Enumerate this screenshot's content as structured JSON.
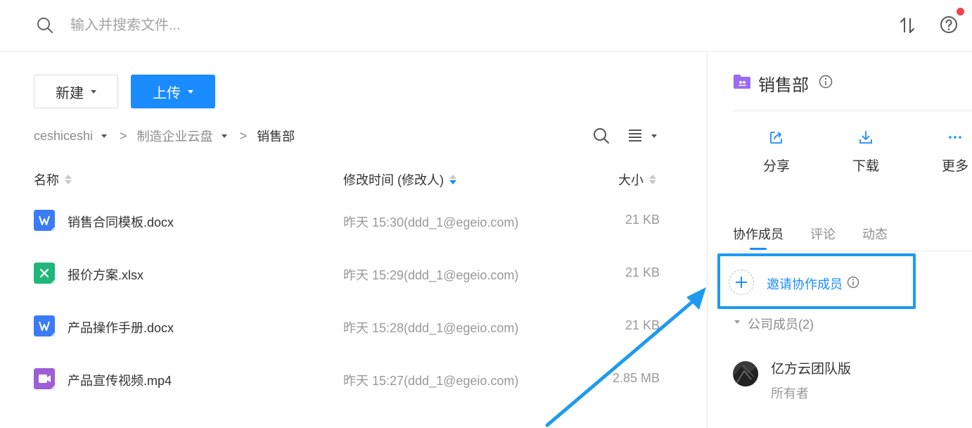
{
  "colors": {
    "accent": "#1a8cff",
    "word_icon": "#3b7cf6",
    "excel_icon": "#21b77a",
    "video_icon": "#9d5fd6",
    "folder_icon": "#9b6bf0",
    "notification_dot": "#f5414e",
    "annotation_arrow": "#1e9bf0"
  },
  "search": {
    "placeholder": "输入并搜索文件..."
  },
  "header_icons": [
    "search-icon",
    "sort-icon",
    "help-icon"
  ],
  "toolbar": {
    "new_label": "新建",
    "upload_label": "上传"
  },
  "breadcrumb": {
    "items": [
      {
        "label": "ceshiceshi",
        "has_dropdown": true
      },
      {
        "label": "制造企业云盘",
        "has_dropdown": true
      },
      {
        "label": "销售部",
        "current": true
      }
    ],
    "separator": ">"
  },
  "columns": {
    "name": "名称",
    "modified": "修改时间 (修改人)",
    "size": "大小"
  },
  "files": [
    {
      "name": "销售合同模板.docx",
      "type": "word",
      "modified": "昨天 15:30(ddd_1@egeio.com)",
      "size": "21 KB"
    },
    {
      "name": "报价方案.xlsx",
      "type": "excel",
      "modified": "昨天 15:29(ddd_1@egeio.com)",
      "size": "21 KB"
    },
    {
      "name": "产品操作手册.docx",
      "type": "word",
      "modified": "昨天 15:28(ddd_1@egeio.com)",
      "size": "21 KB"
    },
    {
      "name": "产品宣传视频.mp4",
      "type": "video",
      "modified": "昨天 15:27(ddd_1@egeio.com)",
      "size": "2.85 MB"
    }
  ],
  "details": {
    "folder_name": "销售部",
    "actions": [
      {
        "label": "分享",
        "icon": "share-icon"
      },
      {
        "label": "下载",
        "icon": "download-icon"
      },
      {
        "label": "更多",
        "icon": "more-icon"
      }
    ],
    "tabs": [
      {
        "label": "协作成员",
        "active": true
      },
      {
        "label": "评论"
      },
      {
        "label": "动态"
      }
    ],
    "invite_label": "邀请协作成员",
    "group_label": "公司成员(2)",
    "member": {
      "name": "亿方云团队版",
      "role": "所有者"
    }
  }
}
